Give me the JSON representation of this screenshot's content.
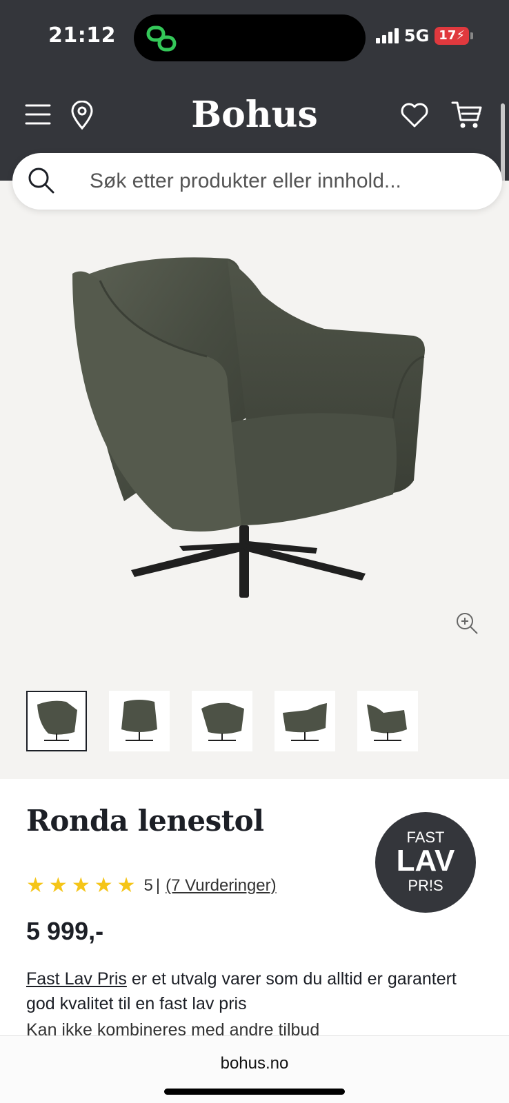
{
  "status_bar": {
    "time": "21:12",
    "network": "5G",
    "battery": "17"
  },
  "header": {
    "brand": "Bohus",
    "icons": [
      "menu-icon",
      "location-pin-icon",
      "heart-icon",
      "cart-icon"
    ]
  },
  "search": {
    "placeholder": "Søk etter produkter eller innhold..."
  },
  "gallery": {
    "thumbnail_count": 5,
    "active_thumbnail": 1
  },
  "product": {
    "title": "Ronda lenestol",
    "badge": {
      "line1": "FAST",
      "line2": "LAV",
      "line3": "PR!S"
    },
    "rating_value": "5",
    "rating_separator": "|",
    "rating_link": "(7 Vurderinger)",
    "stars": 5,
    "price": "5 999,-",
    "desc_link": "Fast Lav Pris",
    "desc_text": " er et utvalg varer som du alltid er garantert god kvalitet til en fast lav pris",
    "desc_note": "Kan ikke kombineres med andre tilbud"
  },
  "browser": {
    "url": "bohus.no"
  },
  "colors": {
    "header_bg": "#34363b",
    "star": "#f5c518",
    "gallery_bg": "#f4f3f1"
  }
}
